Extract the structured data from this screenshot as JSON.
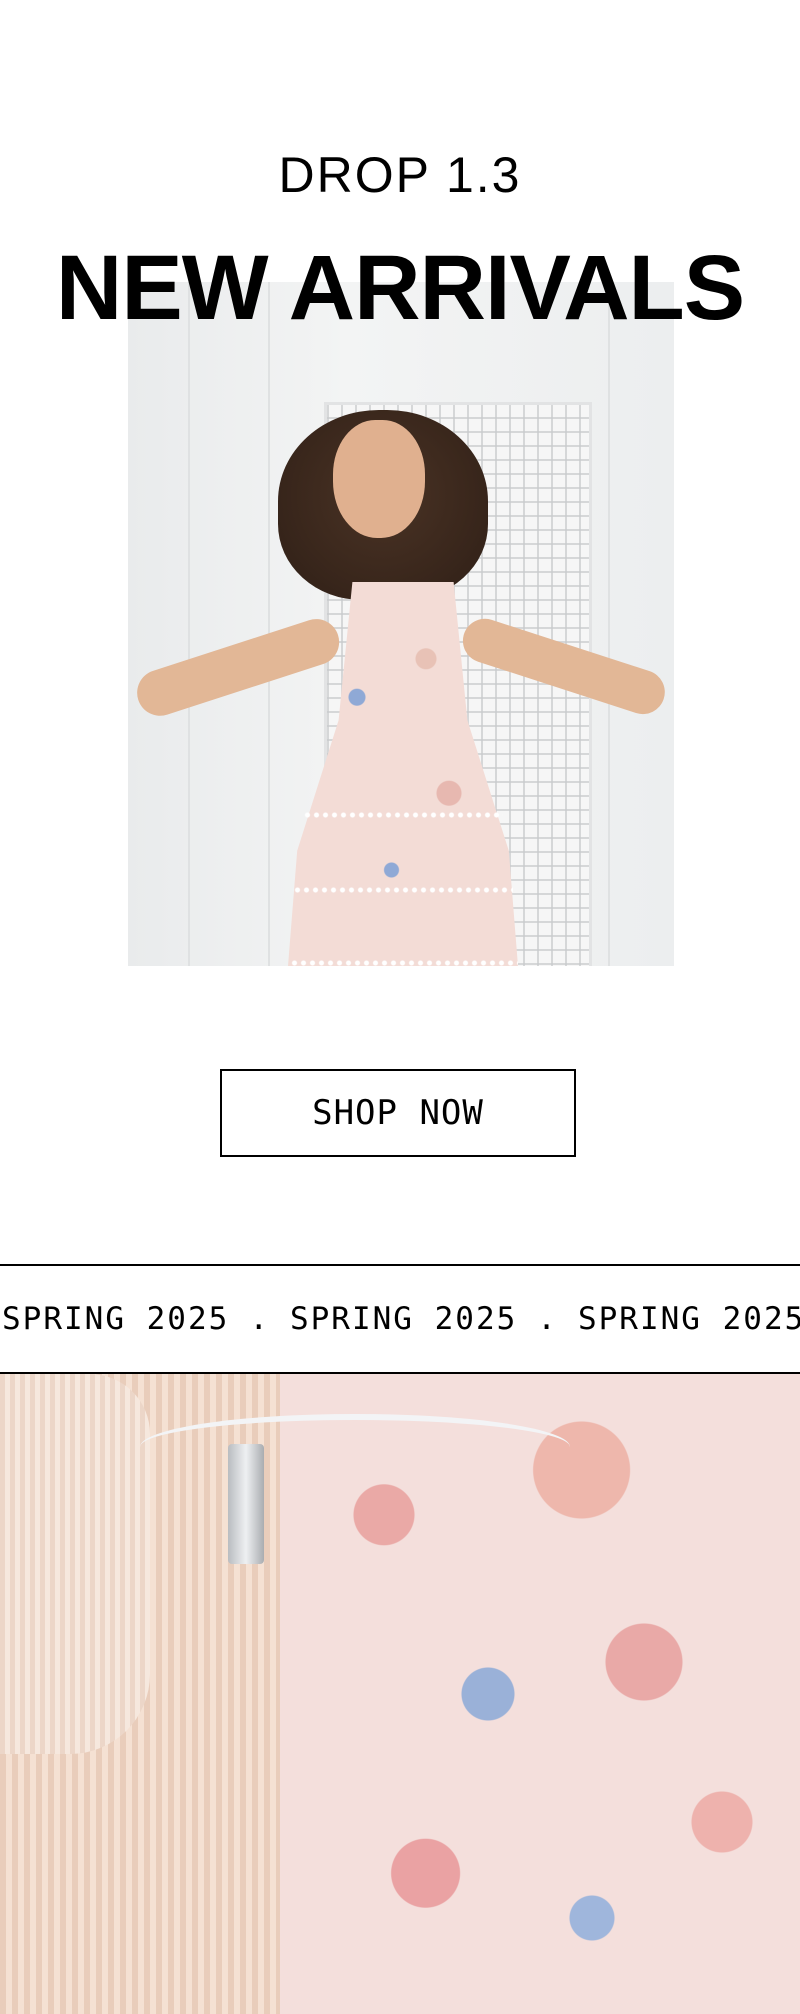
{
  "hero": {
    "kicker": "DROP 1.3",
    "title": "NEW ARRIVALS",
    "photo_alt": "Girl in a floral tiered dress"
  },
  "cta": {
    "label": "SHOP NOW"
  },
  "ticker": {
    "items": [
      "SPRING 2025",
      "SPRING 2025",
      "SPRING 2025"
    ],
    "separator": "."
  },
  "bottom": {
    "photo_alt": "Ribbed pants and floral dress on hangers"
  },
  "colors": {
    "background": "#ffffff",
    "text": "#000000",
    "border": "#000000"
  }
}
